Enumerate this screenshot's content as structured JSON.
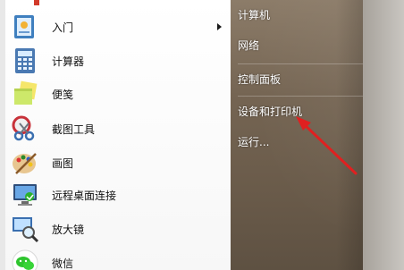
{
  "left_menu": {
    "items": [
      {
        "label": "入门",
        "icon": "getting-started-icon",
        "has_submenu": true
      },
      {
        "label": "计算器",
        "icon": "calculator-icon",
        "has_submenu": false
      },
      {
        "label": "便笺",
        "icon": "sticky-notes-icon",
        "has_submenu": false
      },
      {
        "label": "截图工具",
        "icon": "snipping-tool-icon",
        "has_submenu": false
      },
      {
        "label": "画图",
        "icon": "paint-icon",
        "has_submenu": false
      },
      {
        "label": "远程桌面连接",
        "icon": "remote-desktop-icon",
        "has_submenu": false
      },
      {
        "label": "放大镜",
        "icon": "magnifier-icon",
        "has_submenu": false
      },
      {
        "label": "微信",
        "icon": "wechat-icon",
        "has_submenu": false
      }
    ]
  },
  "right_menu": {
    "items": [
      {
        "label": "计算机"
      },
      {
        "label": "网络"
      },
      {
        "label": "控制面板"
      },
      {
        "label": "设备和打印机"
      },
      {
        "label": "运行..."
      }
    ]
  },
  "colors": {
    "annotation_arrow": "#e02020",
    "right_pane_bg": "#756553"
  }
}
